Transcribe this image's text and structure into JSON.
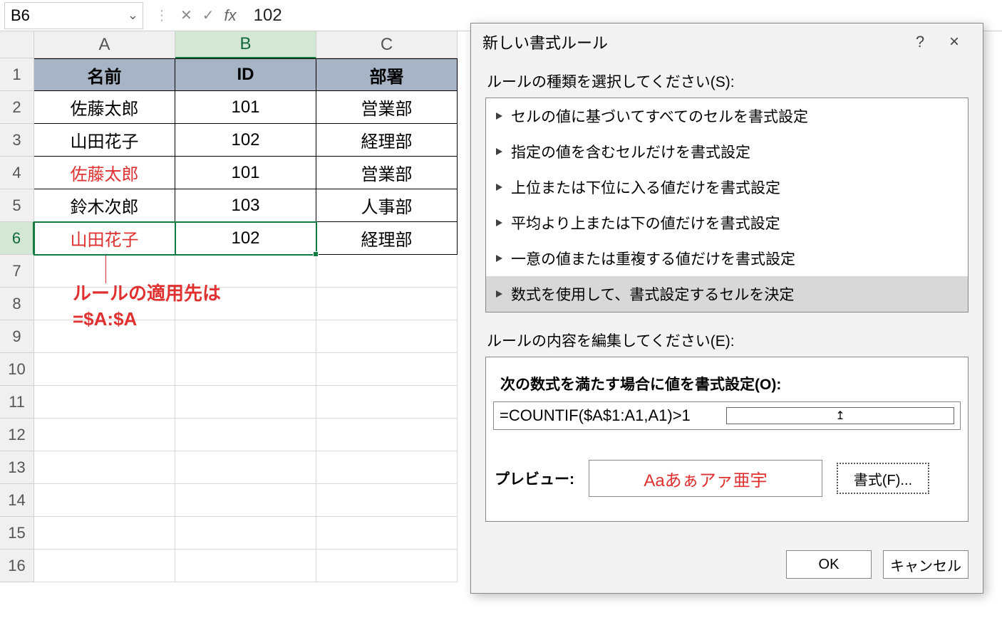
{
  "formula_bar": {
    "name_box": "B6",
    "formula": "102"
  },
  "grid": {
    "columns": [
      "A",
      "B",
      "C"
    ],
    "active_col_index": 1,
    "row_count": 16,
    "active_row": 6,
    "header_row": {
      "a": "名前",
      "b": "ID",
      "c": "部署"
    },
    "rows": [
      {
        "a": "佐藤太郎",
        "b": "101",
        "c": "営業部",
        "a_red": false
      },
      {
        "a": "山田花子",
        "b": "102",
        "c": "経理部",
        "a_red": false
      },
      {
        "a": "佐藤太郎",
        "b": "101",
        "c": "営業部",
        "a_red": true
      },
      {
        "a": "鈴木次郎",
        "b": "103",
        "c": "人事部",
        "a_red": false
      },
      {
        "a": "山田花子",
        "b": "102",
        "c": "経理部",
        "a_red": true
      }
    ]
  },
  "annotation": {
    "line1": "ルールの適用先は",
    "line2": "=$A:$A"
  },
  "dialog": {
    "title": "新しい書式ルール",
    "help": "?",
    "close": "×",
    "select_rule_type_label": "ルールの種類を選択してください(S):",
    "rule_types": [
      "セルの値に基づいてすべてのセルを書式設定",
      "指定の値を含むセルだけを書式設定",
      "上位または下位に入る値だけを書式設定",
      "平均より上または下の値だけを書式設定",
      "一意の値または重複する値だけを書式設定",
      "数式を使用して、書式設定するセルを決定"
    ],
    "selected_rule_index": 5,
    "edit_rule_label": "ルールの内容を編集してください(E):",
    "formula_label": "次の数式を満たす場合に値を書式設定(O):",
    "formula_value": "=COUNTIF($A$1:A1,A1)>1",
    "preview_label": "プレビュー:",
    "preview_sample": "Aaあぁアァ亜宇",
    "format_button": "書式(F)...",
    "ok": "OK",
    "cancel": "キャンセル"
  }
}
